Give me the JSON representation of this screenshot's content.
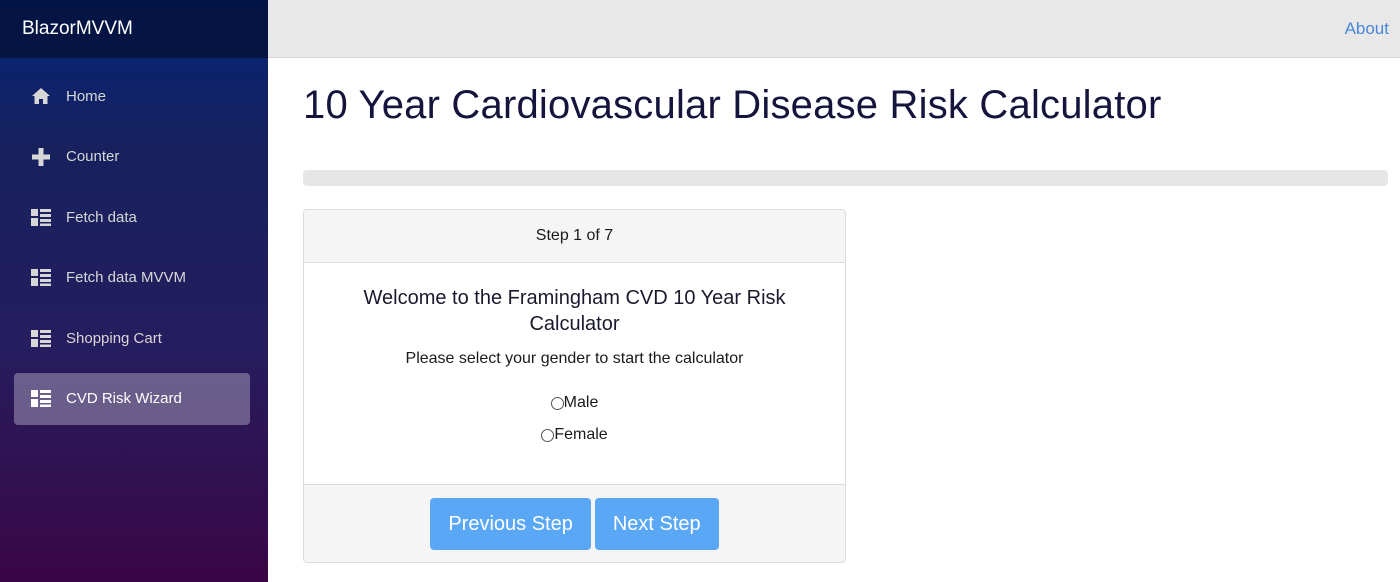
{
  "app": {
    "brand": "BlazorMVVM"
  },
  "sidebar": {
    "items": [
      {
        "label": "Home",
        "icon": "home-icon",
        "active": false
      },
      {
        "label": "Counter",
        "icon": "plus-icon",
        "active": false
      },
      {
        "label": "Fetch data",
        "icon": "list-icon",
        "active": false
      },
      {
        "label": "Fetch data MVVM",
        "icon": "list-icon",
        "active": false
      },
      {
        "label": "Shopping Cart",
        "icon": "list-icon",
        "active": false
      },
      {
        "label": "CVD Risk Wizard",
        "icon": "list-icon",
        "active": true
      }
    ]
  },
  "topbar": {
    "about_label": "About"
  },
  "main": {
    "title": "10 Year Cardiovascular Disease Risk Calculator",
    "progress": 0,
    "wizard": {
      "step_label": "Step 1 of 7",
      "welcome": "Welcome to the Framingham CVD 10 Year Risk Calculator",
      "instruction": "Please select your gender to start the calculator",
      "options": [
        {
          "label": "Male",
          "checked": false
        },
        {
          "label": "Female",
          "checked": false
        }
      ],
      "prev_label": "Previous Step",
      "next_label": "Next Step"
    }
  },
  "colors": {
    "accent_link": "#4a87d9",
    "button": "#5aa8f5",
    "title": "#14143c"
  }
}
